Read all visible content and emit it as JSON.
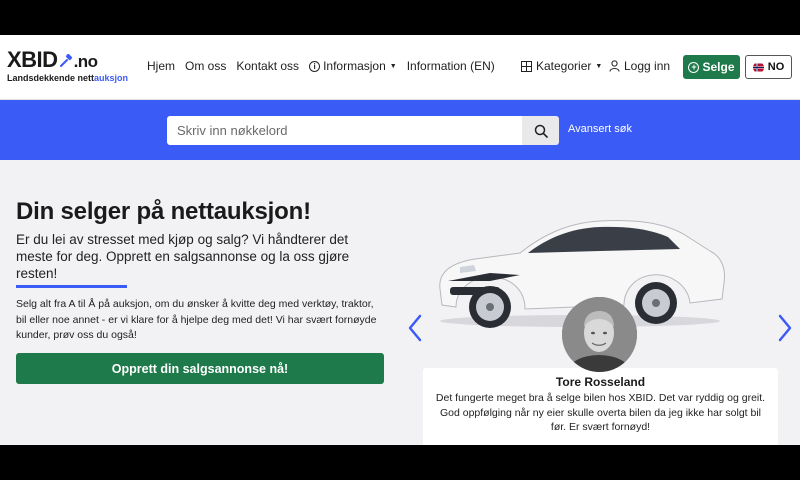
{
  "header": {
    "logo_main": "XBID",
    "logo_suffix": ".no",
    "logo_tag_prefix": "Landsdekkende nett",
    "logo_tag_accent": "auksjon",
    "nav": {
      "home": "Hjem",
      "about": "Om oss",
      "contact": "Kontakt oss",
      "info": "Informasjon",
      "info_en": "Information (EN)"
    },
    "categories": "Kategorier",
    "login": "Logg inn",
    "sell": "Selge",
    "lang": "NO"
  },
  "search": {
    "placeholder": "Skriv inn nøkkelord",
    "advanced": "Avansert søk"
  },
  "hero": {
    "title": "Din selger på nettauksjon!",
    "lead": "Er du lei av stresset med kjøp og salg? Vi håndterer det meste for deg. Opprett en salgsannonse og la oss gjøre resten!",
    "body": "Selg alt fra A til Å på auksjon, om du ønsker å kvitte deg med verktøy, traktor, bil eller noe annet - er vi klare for å hjelpe deg med det! Vi har svært fornøyde kunder, prøv oss du også!",
    "cta": "Opprett din salgsannonse nå!"
  },
  "testimonial": {
    "name": "Tore Rosseland",
    "quote": "Det fungerte meget bra å selge bilen hos XBID. Det var ryddig og greit. God oppfølging når ny eier skulle overta bilen da jeg ikke har solgt bil før. Er svært fornøyd!"
  },
  "colors": {
    "brand_blue": "#3b5bf6",
    "brand_green": "#1e7a4a"
  }
}
